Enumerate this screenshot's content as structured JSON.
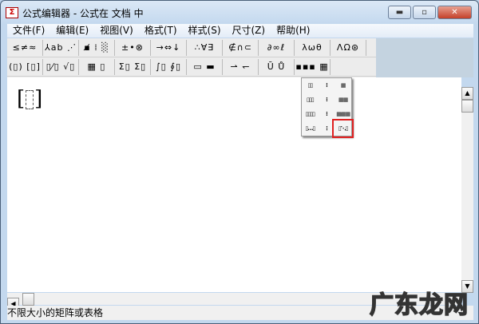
{
  "window": {
    "title": "公式编辑器 - 公式在 文档 中",
    "app_icon": "Σ",
    "minimize": "▬",
    "maximize": "▫",
    "close": "✕"
  },
  "menu": [
    "文件(F)",
    "编辑(E)",
    "视图(V)",
    "格式(T)",
    "样式(S)",
    "尺寸(Z)",
    "帮助(H)"
  ],
  "toolbar": {
    "row1": [
      "≤≠≈",
      "⅄ab ⋰",
      "▪̸ ⁞ ░",
      "±•⊗",
      "→⇔↓",
      "∴∀∃",
      "∉∩⊂",
      "∂∞ℓ",
      "λωθ",
      "ΛΩ⊛"
    ],
    "row2": [
      "(▯) [▯]",
      "▯⁄▯ √▯",
      "▦ ▯",
      "Σ▯ Σ▯",
      "∫▯ ∮▯",
      "▭ ▬",
      "⇀ ↽",
      "Ū Ů",
      "▪▪▪ ▦"
    ]
  },
  "palette": {
    "cells": [
      "▯▯",
      "⁞",
      "▦",
      "▯▯▯",
      "⁞",
      "▦▦",
      "▯▯▯▯",
      "⁞",
      "▦▦▦",
      "▯…▯",
      "⋮",
      "▯⋱▯"
    ],
    "selected_index": 11
  },
  "document": {
    "template": "[ ]"
  },
  "status": "不限大小的矩阵或表格",
  "scrollbar": {
    "up": "▲",
    "down": "▼",
    "left": "◀"
  },
  "watermark": "广东龙网"
}
